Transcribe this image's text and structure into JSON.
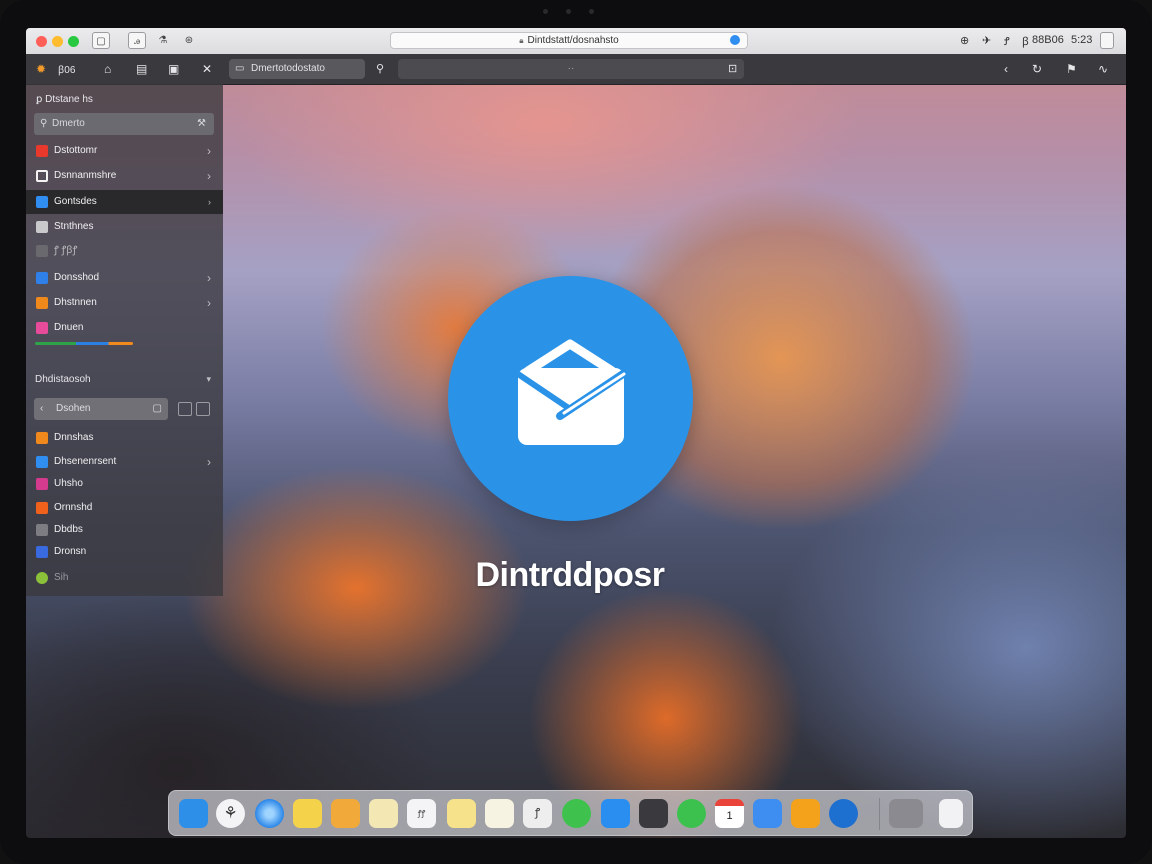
{
  "window": {
    "url": "Dintdstatt/dosnahsto"
  },
  "titlebar": {
    "right_items": [
      "⊕",
      "✈",
      "Ꝭ",
      "ꞵ",
      "88B06",
      "5:23"
    ]
  },
  "toolbar": {
    "app_label": "ꞵ06",
    "search_label": "Dmertotodostato",
    "address_hint": "··"
  },
  "sidebar": {
    "header": "ꝑ Dtstane hs",
    "search_placeholder": "Dmerto",
    "items": [
      {
        "label": "Dstottomr",
        "color": "#e8392c",
        "chevron": true
      },
      {
        "label": "Dsnnanmshre",
        "color": "#f2f2f2",
        "chevron": true
      },
      {
        "label": "Gontsdes",
        "color": "#2f8ef0",
        "chevron": true,
        "selected": true
      },
      {
        "label": "Stnthnes",
        "color": "#c9c9cc",
        "chevron": false
      },
      {
        "label": "ꝭ  ꝭꞵꝭ",
        "color": "#6a6a6e",
        "chevron": false
      },
      {
        "label": "Donsshod",
        "color": "#2f80e8",
        "chevron": true
      },
      {
        "label": "Dhstnnen",
        "color": "#f0891c",
        "chevron": true
      },
      {
        "label": "Dnuen",
        "color": "#e84b9a",
        "chevron": false
      }
    ],
    "section_title": "Dhdistaosoh",
    "sub_search_placeholder": "Dsohen",
    "sub_items": [
      {
        "label": "Dnnshas",
        "color": "#f0891c",
        "chevron": false
      },
      {
        "label": "Dhsenenrsent",
        "color": "#2f8ef0",
        "chevron": true
      },
      {
        "label": "Uhsho",
        "color": "#d43a8e",
        "chevron": false
      },
      {
        "label": "Ornnshd",
        "color": "#f0611c",
        "chevron": false
      },
      {
        "label": "Dbdbs",
        "color": "#7c7c82",
        "chevron": false
      },
      {
        "label": "Dronsn",
        "color": "#3a6ae0",
        "chevron": false
      },
      {
        "label": "Sih",
        "color": "#8ac03a",
        "chevron": false
      }
    ]
  },
  "app": {
    "name": "Dintrddposr"
  },
  "dock": {
    "apps": [
      {
        "name": "finder-icon",
        "color": "#2d8fe8",
        "label": ""
      },
      {
        "name": "launchpad-icon",
        "color": "#f4f4f6",
        "label": ""
      },
      {
        "name": "safari-icon",
        "color": "#3aa0f0",
        "label": ""
      },
      {
        "name": "notes-icon",
        "color": "#f4d24a",
        "label": ""
      },
      {
        "name": "stickies-icon",
        "color": "#f1aa3a",
        "label": ""
      },
      {
        "name": "maps-icon",
        "color": "#f3e7b4",
        "label": ""
      },
      {
        "name": "calendar-icon",
        "color": "#f4f4f6",
        "label": "ꝭꝭ"
      },
      {
        "name": "reminders-icon",
        "color": "#f6e28a",
        "label": ""
      },
      {
        "name": "textedit-icon",
        "color": "#f7f3e2",
        "label": ""
      },
      {
        "name": "preview-icon",
        "color": "#eeeeee",
        "label": "ꝭ"
      },
      {
        "name": "messages-icon",
        "color": "#3ec24d",
        "label": ""
      },
      {
        "name": "appstore-icon",
        "color": "#2a8ef0",
        "label": ""
      },
      {
        "name": "photobooth-icon",
        "color": "#3a3a3e",
        "label": ""
      },
      {
        "name": "facetime-icon",
        "color": "#3cc14f",
        "label": ""
      },
      {
        "name": "ical-icon",
        "color": "#e8443a",
        "label": "1"
      },
      {
        "name": "mail-icon",
        "color": "#3d8ef0",
        "label": ""
      },
      {
        "name": "pages-icon",
        "color": "#f4a21c",
        "label": ""
      },
      {
        "name": "quicktime-icon",
        "color": "#1d6fd0",
        "label": ""
      },
      {
        "name": "downloads-icon",
        "color": "#8a8a90",
        "label": ""
      },
      {
        "name": "trash-icon",
        "color": "#f2f2f4",
        "label": ""
      }
    ]
  }
}
